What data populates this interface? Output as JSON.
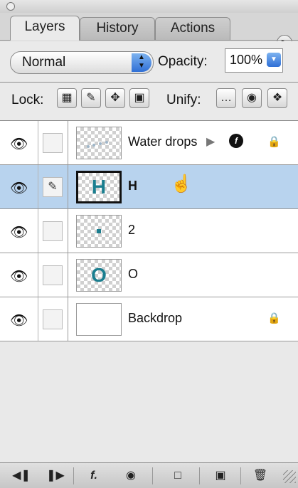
{
  "tabs": [
    {
      "label": "Layers",
      "active": true
    },
    {
      "label": "History",
      "active": false
    },
    {
      "label": "Actions",
      "active": false
    }
  ],
  "blend_mode": "Normal",
  "opacity": {
    "label": "Opacity:",
    "value": "100%"
  },
  "lock": {
    "label": "Lock:"
  },
  "unify": {
    "label": "Unify:"
  },
  "layers": [
    {
      "name": "Water drops",
      "selected": false,
      "thumb_text": "",
      "has_fx": true,
      "locked": true
    },
    {
      "name": "H",
      "selected": true,
      "thumb_text": "H",
      "has_fx": false,
      "locked": false
    },
    {
      "name": "2",
      "selected": false,
      "thumb_text": "",
      "has_fx": false,
      "locked": false
    },
    {
      "name": "O",
      "selected": false,
      "thumb_text": "O",
      "has_fx": false,
      "locked": false
    },
    {
      "name": "Backdrop",
      "selected": false,
      "thumb_text": "",
      "has_fx": false,
      "locked": true
    }
  ],
  "colors": {
    "accent_blue": "#2f6fd6",
    "selection": "#b8d3ee",
    "thumb_teal": "#1a7e8f"
  }
}
